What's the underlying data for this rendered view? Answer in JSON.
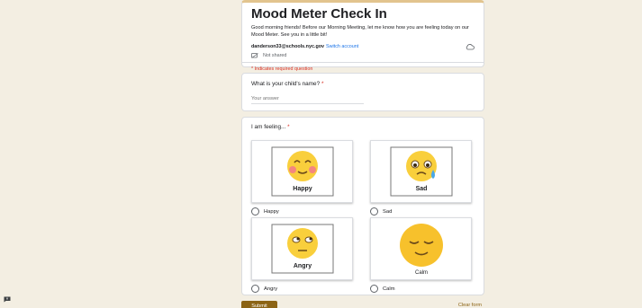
{
  "header": {
    "title": "Mood Meter Check In",
    "description": "Good morning friends! Before our Morning Meeting, let me know how you are feeling today on our Mood Meter. See you in a little bit!",
    "email": "danderson33@schools.nyc.gov",
    "switch_label": "Switch account",
    "shared_label": "Not shared",
    "required_note": "* Indicates required question"
  },
  "q1": {
    "title": "What is your child's name?",
    "asterisk": "*",
    "placeholder": "Your answer"
  },
  "q2": {
    "title": "I am feeling...",
    "asterisk": "*",
    "options": [
      {
        "label": "Happy",
        "caption": "Happy"
      },
      {
        "label": "Sad",
        "caption": "Sad"
      },
      {
        "label": "Angry",
        "caption": "Angry"
      },
      {
        "label": "Calm",
        "caption": "Calm"
      }
    ]
  },
  "actions": {
    "submit": "Submit",
    "clear": "Clear form"
  },
  "colors": {
    "accent": "#8c6415",
    "background": "#f3eee2",
    "required": "#d93025",
    "link": "#1a73e8"
  }
}
